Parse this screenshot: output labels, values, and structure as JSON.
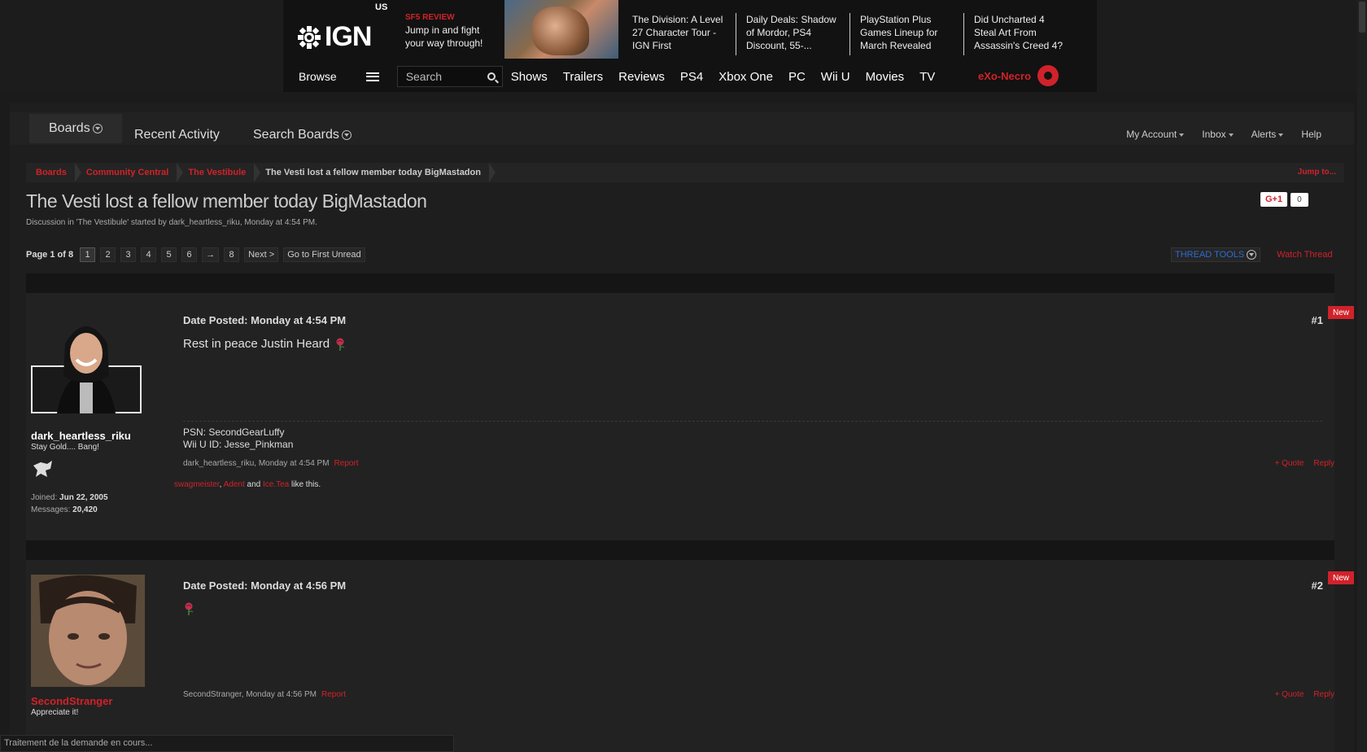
{
  "header": {
    "region": "US",
    "logo": "IGN",
    "promo": {
      "tag": "SF5 REVIEW",
      "text": "Jump in and fight your way through!"
    },
    "headlines": [
      "The Division: A Level 27 Character Tour - IGN First",
      "Daily Deals: Shadow of Mordor, PS4 Discount, 55-...",
      "PlayStation Plus Games Lineup for March Revealed",
      "Did Uncharted 4 Steal Art From Assassin's Creed 4?"
    ],
    "browse_label": "Browse",
    "search_placeholder": "Search",
    "nav": [
      "Shows",
      "Trailers",
      "Reviews",
      "PS4",
      "Xbox One",
      "PC",
      "Wii U",
      "Movies",
      "TV"
    ],
    "username": "eXo-Necro"
  },
  "board_nav": {
    "tabs": [
      "Boards",
      "Recent Activity",
      "Search Boards"
    ],
    "account": [
      "My Account",
      "Inbox",
      "Alerts",
      "Help"
    ]
  },
  "breadcrumbs": [
    "Boards",
    "Community Central",
    "The Vestibule",
    "The Vesti lost a fellow member today BigMastadon"
  ],
  "jump_label": "Jump to...",
  "thread": {
    "title": "The Vesti lost a fellow member today BigMastadon",
    "meta": "Discussion in 'The Vestibule' started by dark_heartless_riku, Monday at 4:54 PM.",
    "gplus_label": "G+1",
    "gplus_count": "0"
  },
  "pager": {
    "label": "Page 1 of 8",
    "pages": [
      "1",
      "2",
      "3",
      "4",
      "5",
      "6",
      "→",
      "8"
    ],
    "next": "Next >",
    "first_unread": "Go to First Unread",
    "thread_tools": "THREAD TOOLS",
    "watch": "Watch Thread"
  },
  "posts": [
    {
      "username": "dark_heartless_riku",
      "user_title": "Stay Gold.... Bang!",
      "joined_label": "Joined:",
      "joined": "Jun 22, 2005",
      "messages_label": "Messages:",
      "messages": "20,420",
      "date": "Date Posted: Monday at 4:54 PM",
      "number": "#1",
      "new_tag": "New",
      "body": "Rest in peace Justin Heard",
      "sig_line1": "PSN: SecondGearLuffy",
      "sig_line2": "Wii U ID: Jesse_Pinkman",
      "footer": "dark_heartless_riku, Monday at 4:54 PM",
      "report": "Report",
      "quote": "+ Quote",
      "reply": "Reply",
      "likers": [
        "swagmeister",
        "Adent",
        "Ice.Tea"
      ],
      "likes_sep": ",",
      "likes_and": "and",
      "likes_suffix": "like this."
    },
    {
      "username": "SecondStranger",
      "user_title": "Appreciate it!",
      "date": "Date Posted: Monday at 4:56 PM",
      "number": "#2",
      "new_tag": "New",
      "footer": "SecondStranger, Monday at 4:56 PM",
      "report": "Report",
      "quote": "+ Quote",
      "reply": "Reply"
    }
  ],
  "status_bar": "Traitement de la demande en cours...",
  "colors": {
    "accent": "#d0222a",
    "link_blue": "#2d6bd2",
    "bg": "#1b1b1b"
  }
}
